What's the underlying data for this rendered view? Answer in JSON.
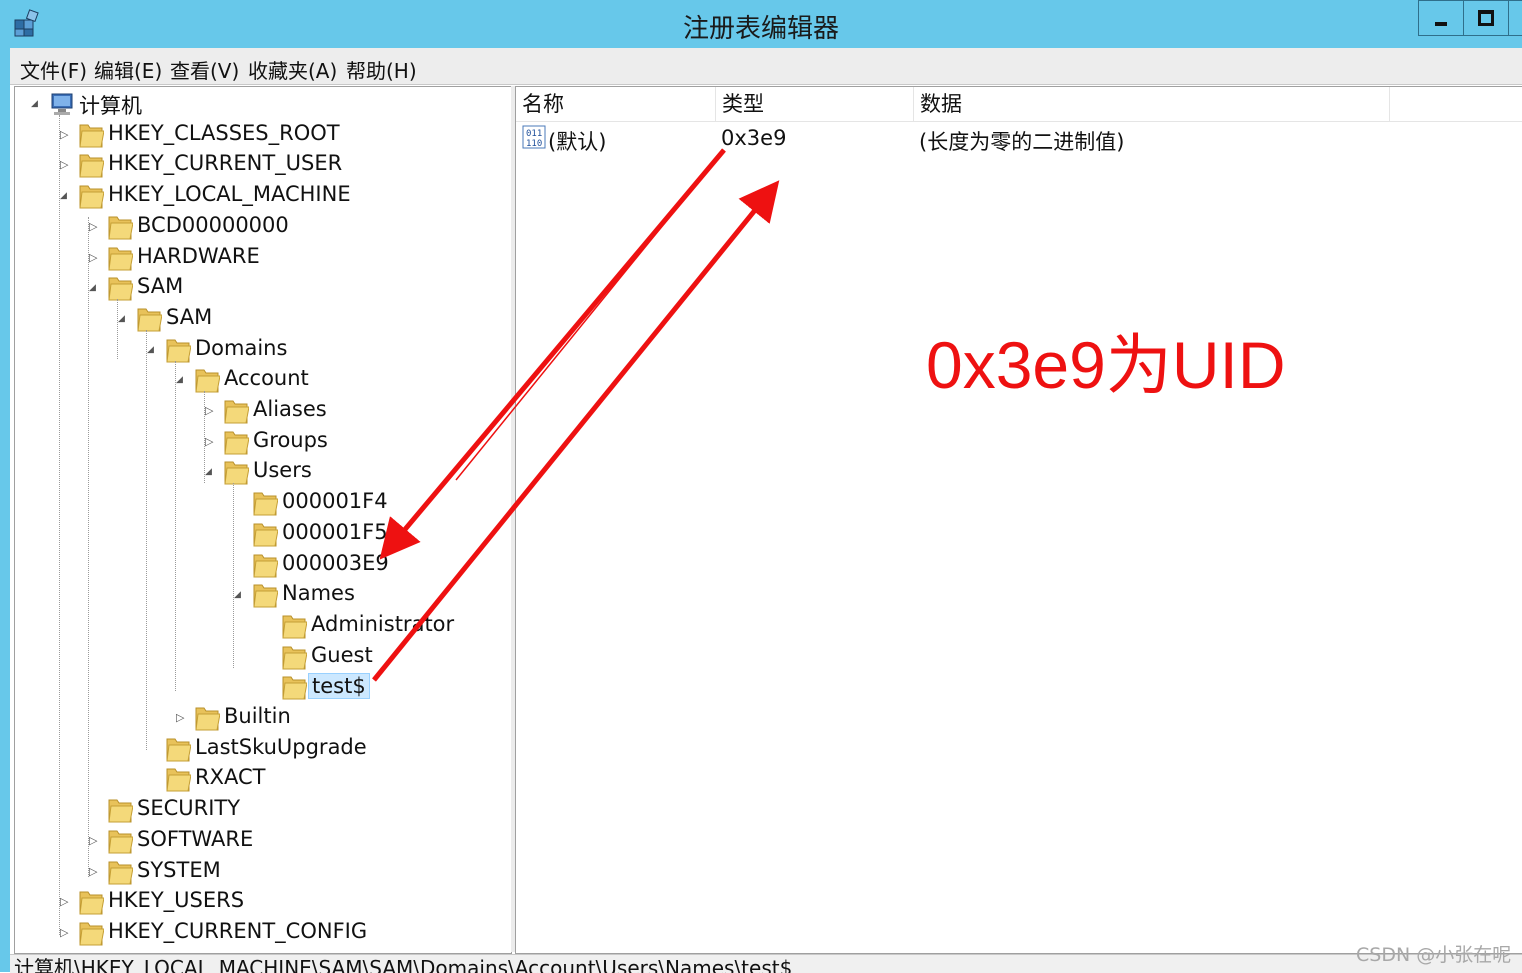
{
  "window": {
    "title": "注册表编辑器",
    "icon": "registry-editor-icon"
  },
  "menu": [
    "文件(F)",
    "编辑(E)",
    "查看(V)",
    "收藏夹(A)",
    "帮助(H)"
  ],
  "tree": [
    {
      "label": "计算机",
      "icon": "computer-icon",
      "expanded": true
    },
    {
      "label": "HKEY_CLASSES_ROOT",
      "expanded": false
    },
    {
      "label": "HKEY_CURRENT_USER",
      "expanded": false
    },
    {
      "label": "HKEY_LOCAL_MACHINE",
      "expanded": true
    },
    {
      "label": "BCD00000000",
      "expanded": false
    },
    {
      "label": "HARDWARE",
      "expanded": false
    },
    {
      "label": "SAM",
      "expanded": true
    },
    {
      "label": "SAM",
      "expanded": true
    },
    {
      "label": "Domains",
      "expanded": true
    },
    {
      "label": "Account",
      "expanded": true
    },
    {
      "label": "Aliases",
      "expanded": false
    },
    {
      "label": "Groups",
      "expanded": false
    },
    {
      "label": "Users",
      "expanded": true
    },
    {
      "label": "000001F4"
    },
    {
      "label": "000001F5"
    },
    {
      "label": "000003E9"
    },
    {
      "label": "Names",
      "expanded": true
    },
    {
      "label": "Administrator"
    },
    {
      "label": "Guest"
    },
    {
      "label": "test$",
      "selected": true
    },
    {
      "label": "Builtin",
      "expanded": false
    },
    {
      "label": "LastSkuUpgrade"
    },
    {
      "label": "RXACT"
    },
    {
      "label": "SECURITY"
    },
    {
      "label": "SOFTWARE",
      "expanded": false
    },
    {
      "label": "SYSTEM",
      "expanded": false
    },
    {
      "label": "HKEY_USERS",
      "expanded": false
    },
    {
      "label": "HKEY_CURRENT_CONFIG",
      "expanded": false
    }
  ],
  "list": {
    "columns": [
      "名称",
      "类型",
      "数据"
    ],
    "rows": [
      {
        "name": "(默认)",
        "type": "0x3e9",
        "data": "(长度为零的二进制值)",
        "icon": "binary-value-icon"
      }
    ]
  },
  "status": {
    "path": "计算机\\HKEY_LOCAL_MACHINE\\SAM\\SAM\\Domains\\Account\\Users\\Names\\test$"
  },
  "annotation": {
    "text": "0x3e9为UID",
    "color": "#ee1111"
  },
  "watermark": "CSDN @小张在呢"
}
